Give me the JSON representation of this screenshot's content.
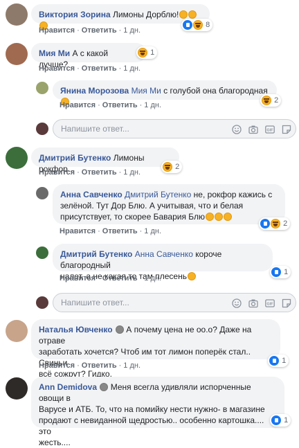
{
  "actions": {
    "like": "Нравится",
    "reply": "Ответить",
    "dot": "·"
  },
  "reply_placeholder": "Напишите ответ...",
  "comments": [
    {
      "author": "Виктория Зорина",
      "text": "Лимоны Дорблю!",
      "time": "1 дн.",
      "reactions": "8"
    },
    {
      "author": "Мия Ми",
      "text": "А с какой лучше?",
      "time": "1 дн.",
      "reactions": "1"
    },
    {
      "author": "Янина Морозова",
      "mention": "Мия Ми",
      "text": "с голубой она благородная",
      "time": "1 дн.",
      "reactions": "2"
    },
    {
      "author": "Дмитрий Бутенко",
      "text": "Лимоны рокфор...",
      "time": "1 дн.",
      "reactions": "2"
    },
    {
      "author": "Анна Савченко",
      "mention": "Дмитрий Бутенко",
      "lines": [
        "не, рокфор кажись с",
        "зелёной. Тут Дор Блю. А учитывая, что и белая",
        "присутствует, то скорее Бавария Блю"
      ],
      "time": "1 дн.",
      "reactions": "2"
    },
    {
      "author": "Дмитрий Бутенко",
      "mention": "Анна Савченко",
      "lines": [
        "короче благородный",
        "налет, а не какая то там плесень"
      ],
      "time": "1 дн.",
      "reactions": "1"
    },
    {
      "author": "Наталья Ювченко",
      "lines": [
        "А почему цена не оо.о? Даже на отраве",
        "заработать хочется? Чтоб им тот лимон поперёк стал.. Свиньи",
        "всё сожрут? Гидко."
      ],
      "time": "1 дн.",
      "reactions": "1"
    },
    {
      "author": "Ann Demidova",
      "lines": [
        "Меня всегла удивляли испорченные овощи в",
        "Варусе и АТБ. То, что на помийку нести нужно- в магазине",
        "продают с невиданной щедростью.. особенно картошка.... это",
        "жесть...."
      ],
      "reactions": "1"
    }
  ]
}
